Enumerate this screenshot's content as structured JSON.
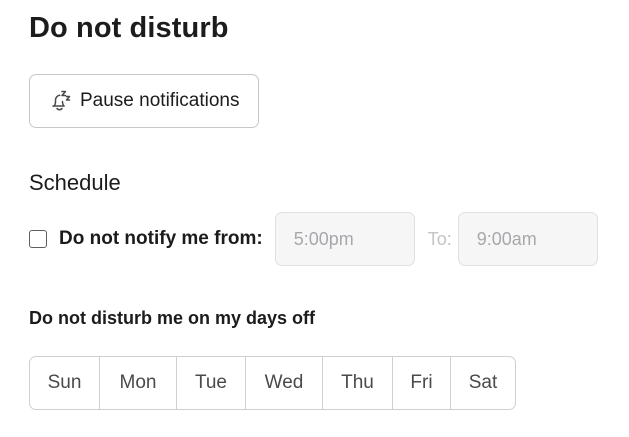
{
  "header": {
    "title": "Do not disturb"
  },
  "pause": {
    "label": "Pause notifications",
    "icon": "bell-snooze-icon"
  },
  "schedule": {
    "heading": "Schedule",
    "checkbox_checked": false,
    "notify_label": "Do not notify me from:",
    "from_value": "5:00pm",
    "to_label": "To:",
    "to_value": "9:00am"
  },
  "days_off": {
    "heading": "Do not disturb me on my days off",
    "days": [
      "Sun",
      "Mon",
      "Tue",
      "Wed",
      "Thu",
      "Fri",
      "Sat"
    ]
  }
}
